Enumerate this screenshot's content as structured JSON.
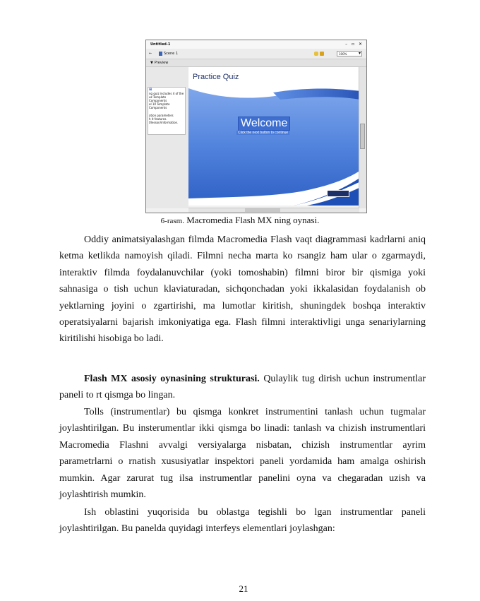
{
  "figure": {
    "window_title": "Untitled-1",
    "toolbar": {
      "scene_label": "Scene 1",
      "zoom": "100%"
    },
    "panel_label": "Preview",
    "properties_lines": [
      "ng quiz includes 4 of the",
      "uz Template Components",
      "el 10 Template Components",
      "",
      "ation parameters",
      "h it features.",
      "t/lesson/information."
    ],
    "stage": {
      "title": "Practice Quiz",
      "welcome": "Welcome",
      "subtitle": "Click the next button to continue"
    }
  },
  "caption": {
    "number": "6-rasm.",
    "text": " Macromedia Flash MX ning oynasi."
  },
  "paragraphs": {
    "p1": "Oddiy animatsiyalashgan filmda Macromedia Flash vaqt diagrammasi kadrlarni aniq ketma ketlikda namoyish qiladi. Filmni necha marta ko   rsangiz ham ular o   zgarmaydi, interaktiv filmda foydalanuvchilar (yoki tomoshabin) filmni biror bir qismiga yoki sahnasiga o tish uchun klaviaturadan, sichqonchadan yoki ikkalasidan foydalanish ob   yektlarning joyini o   zgartirishi, ma   lumotlar kiritish, shuningdek boshqa interaktiv operatsiyalarni bajarish imkoniyatiga ega. Flash filmni interaktivligi unga senariylarning kiritilishi hisobiga bo   ladi.",
    "p2_bold": "Flash MX asosiy oynasining strukturasi.",
    "p2_rest": " Qulaylik tug   dirish uchun instrumentlar paneli to   rt qismga bo   lingan.",
    "p3": "Tolls (instrumentlar) bu qismga konkret instrumentini tanlash uchun tugmalar joylashtirilgan. Bu insterumentlar ikki qismga bo   linadi: tanlash va chizish instrumentlari Macromedia Flashni avvalgi versiyalarga nisbatan, chizish instrumentlar ayrim parametrlarni o   rnatish xususiyatlar inspektori paneli yordamida ham amalga oshirish mumkin. Agar zarurat tug   ilsa instrumentlar panelini oyna va chegaradan    uzish   va joylashtirish mumkin.",
    "p4": "Ish oblastini yuqorisida bu oblastga tegishli bo   lgan instrumentlar paneli joylashtirilgan. Bu panelda quyidagi interfeys elementlari joylashgan:"
  },
  "page_number": "21"
}
